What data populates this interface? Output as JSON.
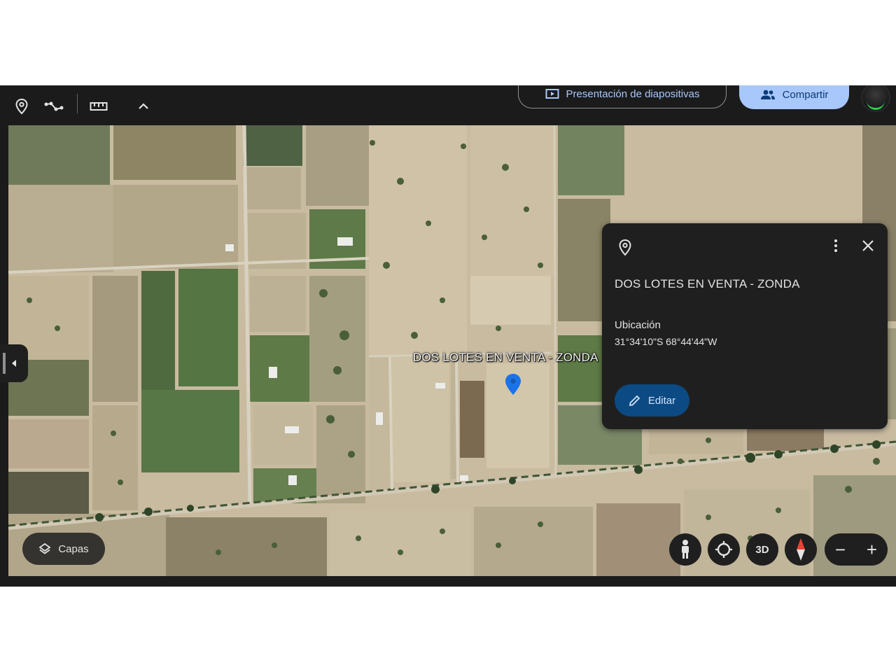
{
  "toolbar": {
    "tools": [
      {
        "icon": "place-pin-icon"
      },
      {
        "icon": "path-line-icon"
      },
      {
        "icon": "ruler-icon"
      },
      {
        "icon": "chevron-up-icon"
      }
    ],
    "slideshow_label": "Presentación de diapositivas",
    "share_label": "Compartir",
    "avatar_icon": "user-avatar"
  },
  "map": {
    "placemark_label": "DOS LOTES EN VENTA - ZONDA",
    "pin_color": "#1a73e8",
    "imagery": "satellite"
  },
  "info_card": {
    "title": "DOS LOTES EN VENTA - ZONDA",
    "location_label": "Ubicación",
    "location_value": "31°34'10\"S 68°44'44\"W",
    "edit_label": "Editar"
  },
  "controls": {
    "layers_label": "Capas",
    "street_view_icon": "pegman-icon",
    "my_location_icon": "my-location-icon",
    "view_3d_label": "3D",
    "compass_icon": "compass-icon",
    "zoom_out_label": "−",
    "zoom_in_label": "+"
  },
  "colors": {
    "accent": "#a8c7fa",
    "edit_button": "#0b4a82",
    "panel": "#1f1f1f"
  }
}
